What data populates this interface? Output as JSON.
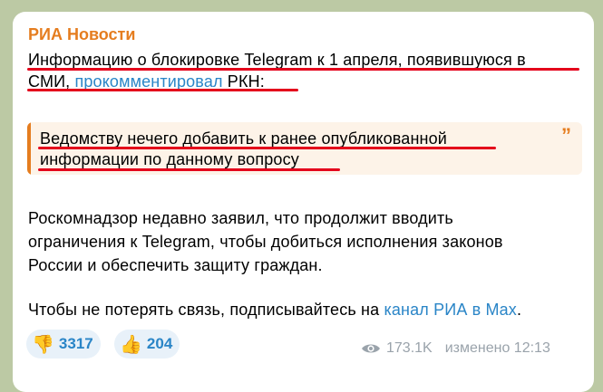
{
  "message": {
    "channel": "РИА Новости",
    "line1": "Информацию о блокировке Telegram к 1 апреля, появившуюся в",
    "line2_pre": "СМИ, ",
    "line2_link": "прокомментировал",
    "line2_post": " РКН:",
    "quote_line1": "Ведомству нечего добавить к ранее опубликованной",
    "quote_line2": "информации по данному вопросу",
    "para1_line1": "Роскомнадзор недавно заявил, что продолжит вводить",
    "para1_line2": "ограничения к Telegram, чтобы добиться исполнения законов",
    "para1_line3": "России и обеспечить защиту граждан.",
    "para2_pre": "Чтобы не потерять связь, подписывайтесь на ",
    "para2_link": "канал РИА в Max",
    "para2_post": "."
  },
  "reactions": [
    {
      "icon": "thumbs-down-icon",
      "emoji": "👎",
      "count": "3317"
    },
    {
      "icon": "thumbs-up-icon",
      "emoji": "👍",
      "count": "204"
    }
  ],
  "meta": {
    "views": "173.1K",
    "edited": "изменено 12:13"
  },
  "colors": {
    "background": "#bcc9a4",
    "channel": "#e57d1f",
    "link": "#2a85c7",
    "underline": "#e4001b",
    "quote_bg": "#fdf3e8"
  }
}
